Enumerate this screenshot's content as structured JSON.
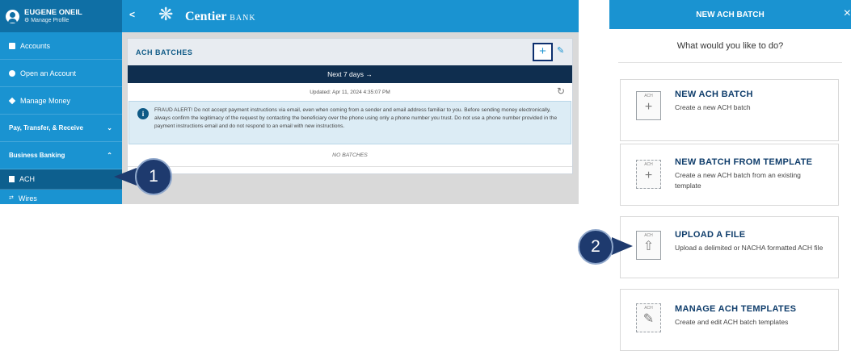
{
  "profile": {
    "name": "EUGENE ONEIL",
    "sub": "⚙ Manage Profile"
  },
  "sidebar": {
    "items": [
      {
        "label": "Accounts"
      },
      {
        "label": "Open an Account"
      },
      {
        "label": "Manage Money"
      },
      {
        "label": "Pay, Transfer, & Receive"
      },
      {
        "label": "Business Banking"
      },
      {
        "label": "ACH"
      },
      {
        "label": "Wires"
      }
    ]
  },
  "topbar": {
    "back": "<",
    "logo_mark": "❋",
    "logo_name": "Centier",
    "logo_bank": "BANK"
  },
  "card": {
    "title": "ACH BATCHES",
    "add": "+",
    "edit": "✎",
    "range": "Next 7 days →",
    "updated": "Updated: Apr 11, 2024 4:35:07 PM",
    "refresh": "↻",
    "alert_icon": "i",
    "alert": "FRAUD ALERT! Do not accept payment instructions via email, even when coming from a sender and email address familiar to you. Before sending money electronically, always confirm the legitimacy of the request by contacting the beneficiary over the phone using only a phone number you trust. Do not use a phone number provided in the payment instructions email and do not respond to an email with new instructions.",
    "empty": "NO BATCHES"
  },
  "callouts": {
    "one": "1",
    "two": "2"
  },
  "panel": {
    "title": "NEW ACH BATCH",
    "close": "×",
    "question": "What would you like to do?",
    "options": [
      {
        "icon_label": "ACH",
        "icon": "plus-icon",
        "glyph": "+",
        "title": "NEW ACH BATCH",
        "desc": "Create a new ACH batch"
      },
      {
        "icon_label": "ACH",
        "icon": "plus-icon",
        "glyph": "+",
        "title": "NEW BATCH FROM TEMPLATE",
        "desc": "Create a new ACH batch from an existing template"
      },
      {
        "icon_label": "ACH",
        "icon": "upload-arrow-icon",
        "glyph": "⇧",
        "title": "UPLOAD A FILE",
        "desc": "Upload a delimited or NACHA formatted ACH file"
      },
      {
        "icon_label": "ACH",
        "icon": "pencil-icon",
        "glyph": "✎",
        "title": "MANAGE ACH TEMPLATES",
        "desc": "Create and edit ACH batch templates"
      }
    ]
  },
  "colors": {
    "brand_blue": "#1a93d1",
    "dark_navy": "#0f2e4f",
    "callout": "#1e3a6e"
  }
}
